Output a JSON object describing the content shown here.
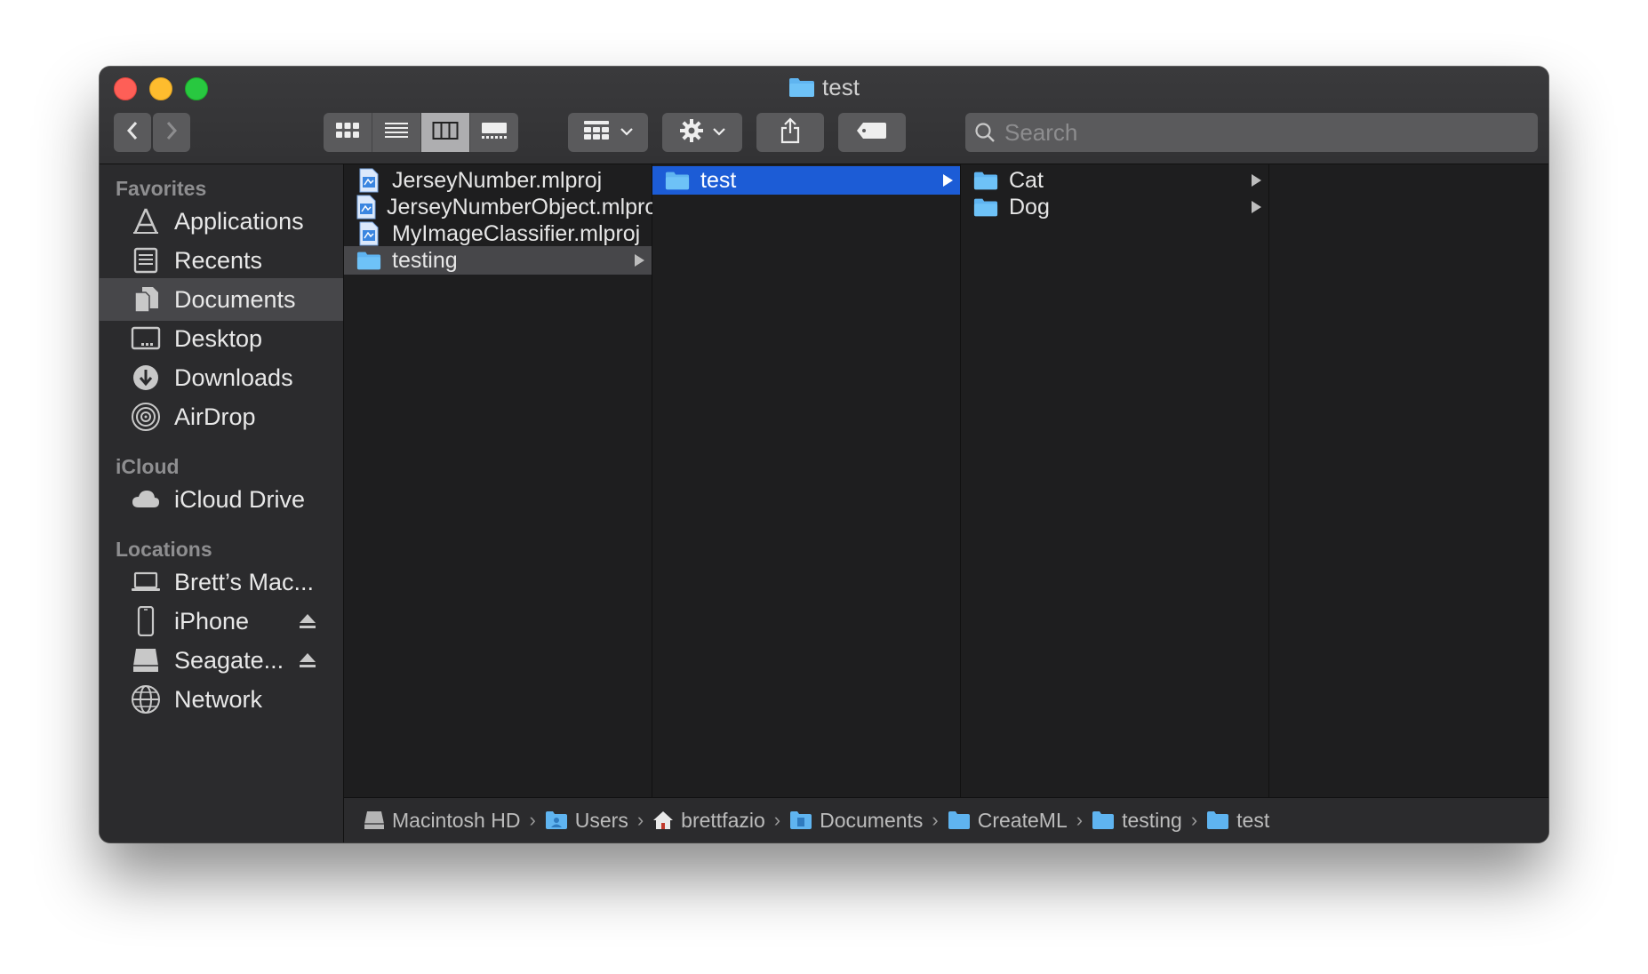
{
  "window": {
    "title": "test"
  },
  "toolbar": {
    "back_icon": "chevron-left-icon",
    "forward_icon": "chevron-right-icon",
    "view_modes": [
      "icon-view",
      "list-view",
      "column-view",
      "gallery-view"
    ],
    "active_view": "column-view",
    "group_icon": "group-by-icon",
    "action_icon": "gear-icon",
    "share_icon": "share-icon",
    "tag_icon": "tag-icon",
    "search_placeholder": "Search"
  },
  "sidebar": {
    "favorites_label": "Favorites",
    "favorites": [
      {
        "label": "Applications",
        "icon": "applications-icon"
      },
      {
        "label": "Recents",
        "icon": "recents-icon"
      },
      {
        "label": "Documents",
        "icon": "documents-icon",
        "selected": true
      },
      {
        "label": "Desktop",
        "icon": "desktop-icon"
      },
      {
        "label": "Downloads",
        "icon": "downloads-icon"
      },
      {
        "label": "AirDrop",
        "icon": "airdrop-icon"
      }
    ],
    "icloud_label": "iCloud",
    "icloud": [
      {
        "label": "iCloud Drive",
        "icon": "cloud-icon"
      }
    ],
    "locations_label": "Locations",
    "locations": [
      {
        "label": "Brett’s Mac...",
        "icon": "laptop-icon"
      },
      {
        "label": "iPhone",
        "icon": "iphone-icon",
        "eject": true
      },
      {
        "label": "Seagate...",
        "icon": "drive-icon",
        "eject": true
      },
      {
        "label": "Network",
        "icon": "network-icon"
      }
    ]
  },
  "columns": [
    {
      "items": [
        {
          "label": "JerseyNumber.mlproj",
          "type": "file"
        },
        {
          "label": "JerseyNumberObject.mlproj",
          "type": "file"
        },
        {
          "label": "MyImageClassifier.mlproj",
          "type": "file"
        },
        {
          "label": "testing",
          "type": "folder",
          "selected": "inactive"
        }
      ]
    },
    {
      "items": [
        {
          "label": "test",
          "type": "folder",
          "selected": "active"
        }
      ]
    },
    {
      "items": [
        {
          "label": "Cat",
          "type": "folder"
        },
        {
          "label": "Dog",
          "type": "folder"
        }
      ]
    },
    {
      "items": []
    }
  ],
  "pathbar": [
    {
      "label": "Macintosh HD",
      "icon": "hard-disk-icon"
    },
    {
      "label": "Users",
      "icon": "users-folder-icon"
    },
    {
      "label": "brettfazio",
      "icon": "home-icon"
    },
    {
      "label": "Documents",
      "icon": "documents-folder-icon"
    },
    {
      "label": "CreateML",
      "icon": "folder-icon"
    },
    {
      "label": "testing",
      "icon": "folder-icon"
    },
    {
      "label": "test",
      "icon": "folder-icon"
    }
  ],
  "colors": {
    "selection_blue": "#1c5cd6",
    "folder_blue": "#5fb4f0"
  }
}
